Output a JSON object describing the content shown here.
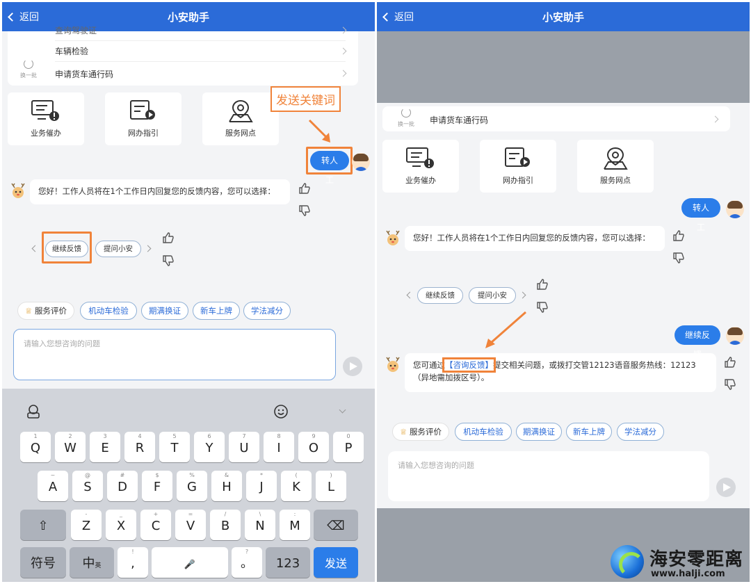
{
  "header": {
    "back_label": "返回",
    "title": "小安助手"
  },
  "left": {
    "partial_row": "查询驾驶证",
    "list_items": [
      "车辆检验",
      "申请货车通行码"
    ],
    "refresh_label": "换一批",
    "tiles": [
      "业务催办",
      "网办指引",
      "服务网点"
    ],
    "annotation": "发送关键词",
    "user_message": "转人工",
    "bot_message": "您好！工作人员将在1个工作日内回复您的反馈内容，您可以选择：",
    "options": [
      "继续反馈",
      "提问小安"
    ],
    "eval_label": "服务评价",
    "quick_chips": [
      "机动车检验",
      "期满换证",
      "新车上牌",
      "学法减分"
    ],
    "input_placeholder": "请输入您想咨询的问题",
    "keyboard": {
      "row1": [
        {
          "k": "Q",
          "h": "1"
        },
        {
          "k": "W",
          "h": "2"
        },
        {
          "k": "E",
          "h": "3"
        },
        {
          "k": "R",
          "h": "4"
        },
        {
          "k": "T",
          "h": "5"
        },
        {
          "k": "Y",
          "h": "6"
        },
        {
          "k": "U",
          "h": "7"
        },
        {
          "k": "I",
          "h": "8"
        },
        {
          "k": "O",
          "h": "9"
        },
        {
          "k": "P",
          "h": "0"
        }
      ],
      "row2": [
        {
          "k": "A",
          "h": "~"
        },
        {
          "k": "S",
          "h": "@"
        },
        {
          "k": "D",
          "h": "#"
        },
        {
          "k": "F",
          "h": "$"
        },
        {
          "k": "G",
          "h": "%"
        },
        {
          "k": "H",
          "h": "&"
        },
        {
          "k": "J",
          "h": "*"
        },
        {
          "k": "K",
          "h": "("
        },
        {
          "k": "L",
          "h": ")"
        }
      ],
      "row3": [
        {
          "k": "Z",
          "h": "-"
        },
        {
          "k": "X",
          "h": "_"
        },
        {
          "k": "C",
          "h": "+"
        },
        {
          "k": "V",
          "h": "="
        },
        {
          "k": "B",
          "h": "/"
        },
        {
          "k": "N",
          "h": "\\"
        },
        {
          "k": "M",
          "h": ":"
        }
      ],
      "symbol_key": "符号",
      "lang_key": "中",
      "lang_sub": "英",
      "comma_key": ",",
      "comma_hint": "!",
      "period_key": "。",
      "period_hint": "?",
      "num_key": "123",
      "send_key": "发送"
    }
  },
  "right": {
    "list_items": [
      "申请货车通行码"
    ],
    "refresh_label": "换一批",
    "tiles": [
      "业务催办",
      "网办指引",
      "服务网点"
    ],
    "user_message_1": "转人工",
    "bot_message_1": "您好！工作人员将在1个工作日内回复您的反馈内容，您可以选择：",
    "options": [
      "继续反馈",
      "提问小安"
    ],
    "user_message_2": "继续反馈",
    "bot_message_2_prefix": "您可通过",
    "bot_message_2_link": "【咨询反馈】",
    "bot_message_2_suffix": "提交相关问题，或拨打交管12123语音服务热线：12123（异地需加拨区号）。",
    "eval_label": "服务评价",
    "quick_chips": [
      "机动车检验",
      "期满换证",
      "新车上牌",
      "学法减分"
    ],
    "input_placeholder": "请输入您想咨询的问题"
  },
  "watermark": {
    "name": "海安零距离",
    "url": "www.halji.com"
  },
  "colors": {
    "primary": "#2b6bd8",
    "annotation": "#f0833a",
    "user_bubble": "#2b7de9"
  }
}
